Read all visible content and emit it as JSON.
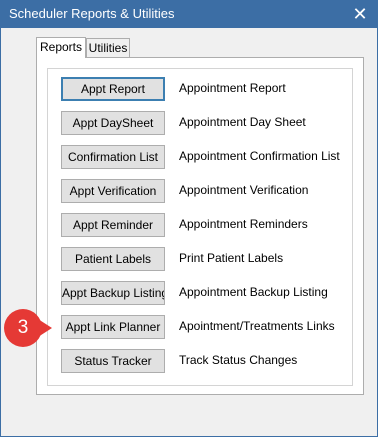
{
  "window": {
    "title": "Scheduler Reports & Utilities",
    "close_glyph": "✕"
  },
  "tabs": [
    {
      "label": "Reports",
      "active": true
    },
    {
      "label": "Utilities",
      "active": false
    }
  ],
  "rows": [
    {
      "button": "Appt Report",
      "description": "Appointment Report"
    },
    {
      "button": "Appt DaySheet",
      "description": "Appointment Day Sheet"
    },
    {
      "button": "Confirmation List",
      "description": "Appointment Confirmation List"
    },
    {
      "button": "Appt Verification",
      "description": "Appointment Verification"
    },
    {
      "button": "Appt Reminder",
      "description": "Appointment Reminders"
    },
    {
      "button": "Patient Labels",
      "description": "Print Patient Labels"
    },
    {
      "button": "Appt Backup Listing",
      "description": "Appointment Backup Listing"
    },
    {
      "button": "Appt Link Planner",
      "description": "Apointment/Treatments Links"
    },
    {
      "button": "Status Tracker",
      "description": "Track Status Changes"
    }
  ],
  "callout": {
    "number": "3",
    "color": "#e53935"
  },
  "colors": {
    "titlebar": "#3c6ea5",
    "focus_border": "#3c7fb1"
  }
}
